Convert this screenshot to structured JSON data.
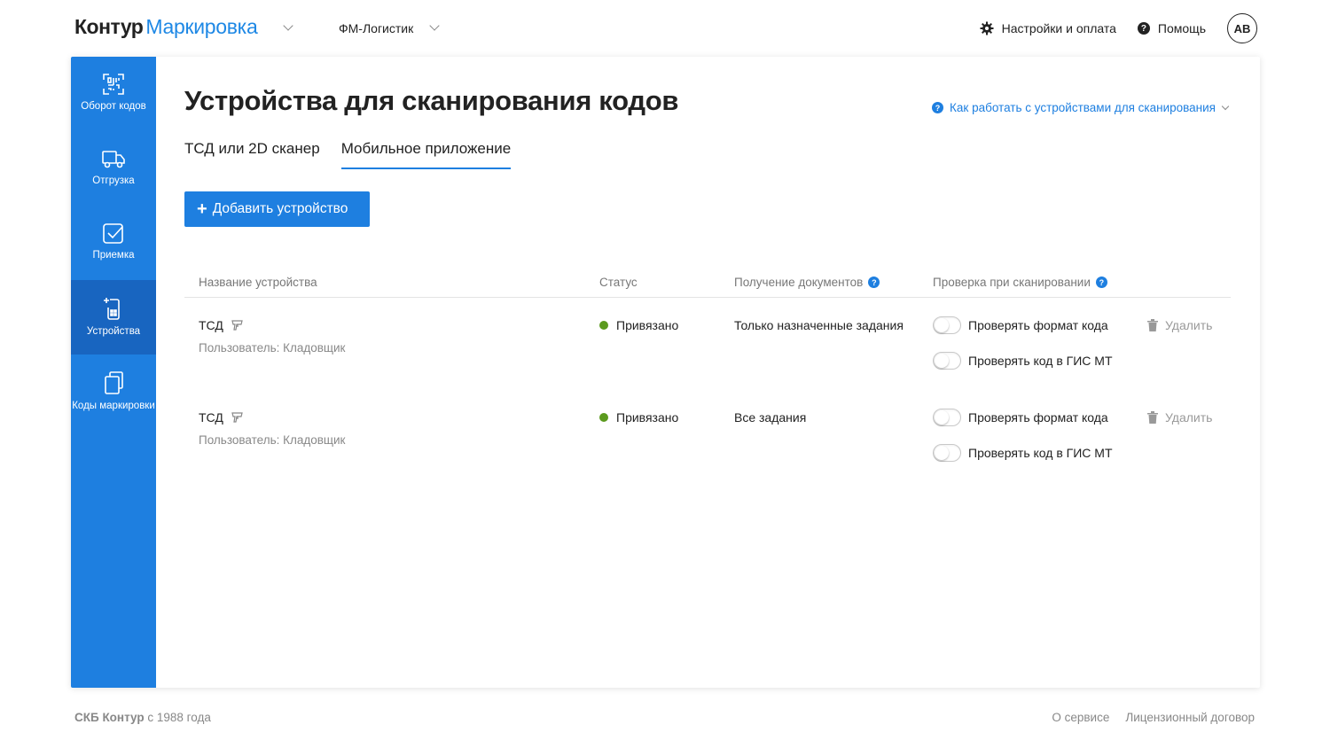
{
  "header": {
    "brand": "Контур",
    "product": "Маркировка",
    "org": "ФМ-Логистик",
    "settings": "Настройки и оплата",
    "help": "Помощь",
    "avatar": "AB"
  },
  "sidebar": {
    "items": [
      {
        "label": "Оборот кодов",
        "icon": "barcode-icon"
      },
      {
        "label": "Отгрузка",
        "icon": "truck-icon"
      },
      {
        "label": "Приемка",
        "icon": "checkbox-icon"
      },
      {
        "label": "Устройства",
        "icon": "device-icon",
        "active": true
      },
      {
        "label": "Коды маркировки",
        "icon": "copy-icon"
      }
    ]
  },
  "page": {
    "title": "Устройства для сканирования кодов",
    "how_link": "Как работать с устройствами для сканирования",
    "tabs": [
      "ТСД или 2D сканер",
      "Мобильное приложение"
    ],
    "active_tab": 1,
    "add_button": "Добавить устройство"
  },
  "table": {
    "columns": [
      "Название устройства",
      "Статус",
      "Получение документов",
      "Проверка при сканировании"
    ],
    "rows": [
      {
        "name": "ТСД",
        "user": "Пользователь: Кладовщик",
        "status": "Привязано",
        "docs": "Только назначенные задания",
        "check_format": "Проверять формат кода",
        "check_gis": "Проверять код в ГИС МТ",
        "delete": "Удалить"
      },
      {
        "name": "ТСД",
        "user": "Пользователь: Кладовщик",
        "status": "Привязано",
        "docs": "Все задания",
        "check_format": "Проверять формат кода",
        "check_gis": "Проверять код в ГИС МТ",
        "delete": "Удалить"
      }
    ]
  },
  "footer": {
    "company": "СКБ Контур",
    "since": "с 1988 года",
    "about": "О сервисе",
    "license": "Лицензионный договор"
  },
  "colors": {
    "accent": "#1e7fe0",
    "sidebar_active": "#1865c0",
    "status_ok": "#5b9a1e"
  }
}
